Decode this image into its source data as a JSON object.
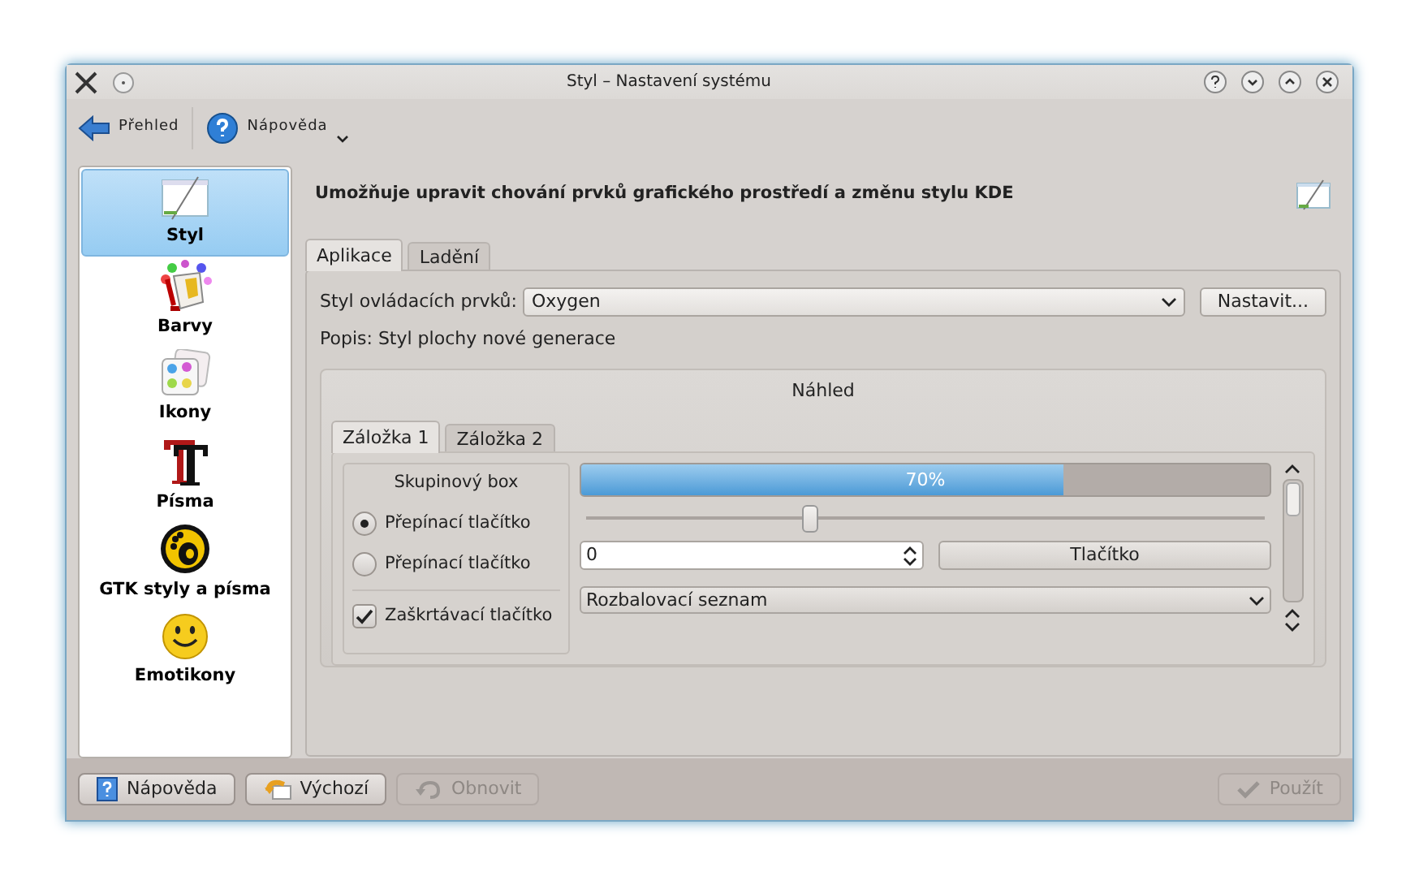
{
  "window": {
    "title": "Styl – Nastavení systému"
  },
  "toolbar": [
    {
      "label": "Přehled"
    },
    {
      "label": "Nápověda"
    }
  ],
  "sidebar": {
    "items": [
      {
        "label": "Styl",
        "selected": true
      },
      {
        "label": "Barvy",
        "selected": false
      },
      {
        "label": "Ikony",
        "selected": false
      },
      {
        "label": "Písma",
        "selected": false
      },
      {
        "label": "GTK styly a písma",
        "selected": false
      },
      {
        "label": "Emotikony",
        "selected": false
      }
    ]
  },
  "header": "Umožňuje upravit chování prvků grafického prostředí a změnu stylu KDE",
  "tabs": [
    {
      "label": "Aplikace",
      "selected": true
    },
    {
      "label": "Ladění",
      "selected": false
    }
  ],
  "widget_style": {
    "label": "Styl ovládacích prvků:",
    "value": "Oxygen",
    "button": "Nastavit..."
  },
  "description": "Popis: Styl plochy nové generace",
  "preview": {
    "title": "Náhled",
    "tabs": [
      {
        "label": "Záložka 1",
        "selected": true
      },
      {
        "label": "Záložka 2",
        "selected": false
      }
    ],
    "group": {
      "title": "Skupinový box",
      "radios": [
        {
          "label": "Přepínací tlačítko",
          "checked": true
        },
        {
          "label": "Přepínací tlačítko",
          "checked": false
        }
      ],
      "checkbox": {
        "label": "Zaškrtávací tlačítko",
        "checked": true
      }
    },
    "progress": {
      "level": 0.7,
      "text": "70%"
    },
    "slider": {
      "level": 0.33
    },
    "spinbox": {
      "value": "0"
    },
    "button": "Tlačítko",
    "combo": {
      "value": "Rozbalovací seznam"
    }
  },
  "buttons": [
    {
      "label": "Nápověda",
      "disabled": false
    },
    {
      "label": "Výchozí",
      "disabled": false
    },
    {
      "label": "Obnovit",
      "disabled": true
    },
    {
      "label": "Použít",
      "disabled": true
    }
  ]
}
